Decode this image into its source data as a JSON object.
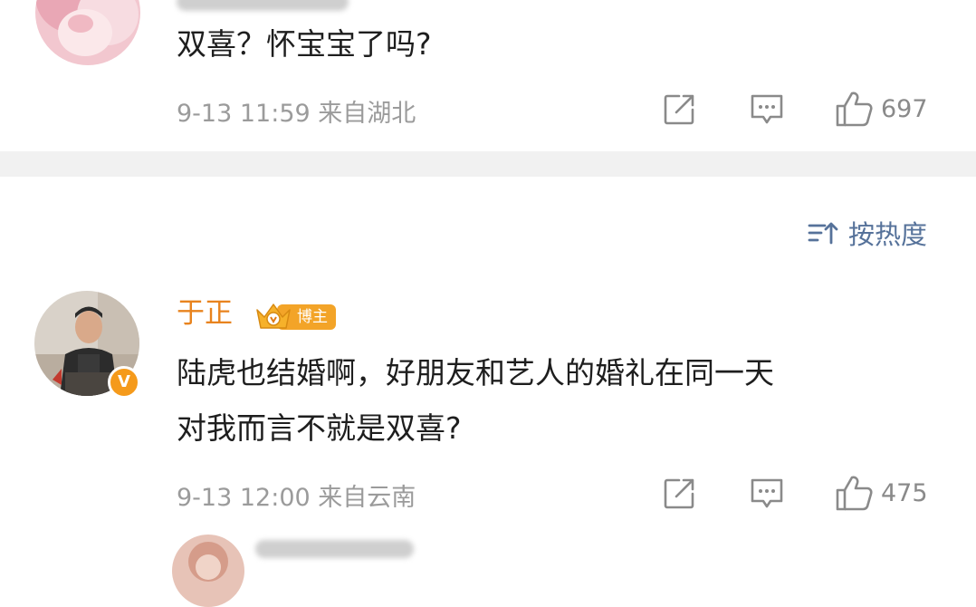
{
  "comment1": {
    "text": "双喜？怀宝宝了吗?",
    "meta": "9-13 11:59  来自湖北",
    "likes": "697"
  },
  "sort": {
    "label": "按热度"
  },
  "comment2": {
    "author": "于正",
    "badge": "博主",
    "verified_mark": "V",
    "text_line1": "陆虎也结婚啊，好朋友和艺人的婚礼在同一天",
    "text_line2": "对我而言不就是双喜?",
    "meta": "9-13 12:00  来自云南",
    "likes": "475"
  },
  "icons": {
    "share": "share-icon",
    "comment": "comment-icon",
    "like": "thumbs-up-icon",
    "sort": "sort-icon"
  },
  "colors": {
    "author_name": "#e8831e",
    "link_blue": "#56729a",
    "meta_gray": "#9b9b9b",
    "divider": "#f1f1f1"
  }
}
